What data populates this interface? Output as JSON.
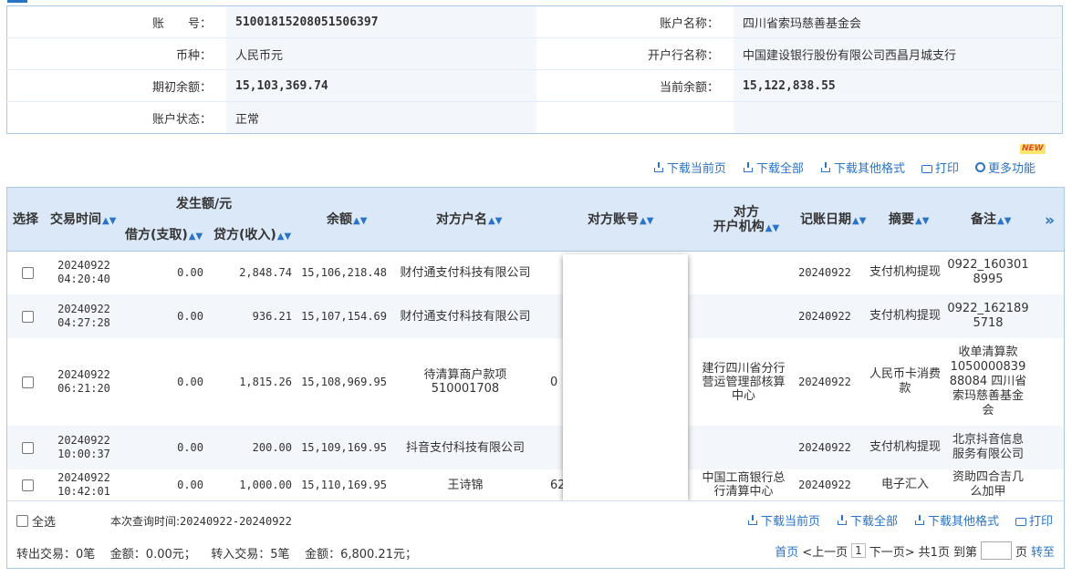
{
  "account": {
    "acct_no_label": "账　　号：",
    "acct_no": "51001815208051506397",
    "acct_name_label": "账户名称：",
    "acct_name": "四川省索玛慈善基金会",
    "currency_label": "币种：",
    "currency": "人民币元",
    "bank_label": "开户行名称：",
    "bank": "中国建设银行股份有限公司西昌月城支行",
    "opening_label": "期初余额：",
    "opening": "15,103,369.74",
    "current_label": "当前余额：",
    "current": "15,122,838.55",
    "status_label": "账户状态：",
    "status": "正常"
  },
  "toolbar": {
    "download_page": "下载当前页",
    "download_all": "下载全部",
    "download_other": "下载其他格式",
    "print": "打印",
    "more": "更多功能",
    "new_badge": "NEW"
  },
  "headers": {
    "select": "选择",
    "time": "交易时间",
    "amount_group": "发生额/元",
    "debit": "借方(支取)",
    "credit": "贷方(收入)",
    "balance": "余额",
    "cp_name": "对方户名",
    "cp_acct": "对方账号",
    "cp_bank_l1": "对方",
    "cp_bank_l2": "开户机构",
    "book_date": "记账日期",
    "memo": "摘要",
    "note": "备注",
    "more_arrow": "»"
  },
  "rows": [
    {
      "time_d": "20240922",
      "time_t": "04:20:40",
      "debit": "0.00",
      "credit": "2,848.74",
      "balance": "15,106,218.48",
      "cp_name": "财付通支付科技有限公司",
      "cp_acct": "",
      "cp_bank": "",
      "date": "20240922",
      "memo": "支付机构提现",
      "note": "0922_160301 8995"
    },
    {
      "time_d": "20240922",
      "time_t": "04:27:28",
      "debit": "0.00",
      "credit": "936.21",
      "balance": "15,107,154.69",
      "cp_name": "财付通支付科技有限公司",
      "cp_acct": "",
      "cp_bank": "",
      "date": "20240922",
      "memo": "支付机构提现",
      "note": "0922_162189 5718"
    },
    {
      "time_d": "20240922",
      "time_t": "06:21:20",
      "debit": "0.00",
      "credit": "1,815.26",
      "balance": "15,108,969.95",
      "cp_name": "待清算商户款项510001708",
      "cp_acct": "0",
      "cp_bank": "建行四川省分行营运管理部核算中心",
      "date": "20240922",
      "memo": "人民币卡消费款",
      "note": "收单清算款 1050000839 88084 四川省索玛慈善基金会"
    },
    {
      "time_d": "20240922",
      "time_t": "10:00:37",
      "debit": "0.00",
      "credit": "200.00",
      "balance": "15,109,169.95",
      "cp_name": "抖音支付科技有限公司",
      "cp_acct": "",
      "cp_bank": "",
      "date": "20240922",
      "memo": "支付机构提现",
      "note": "北京抖音信息服务有限公司"
    },
    {
      "time_d": "20240922",
      "time_t": "10:42:01",
      "debit": "0.00",
      "credit": "1,000.00",
      "balance": "15,110,169.95",
      "cp_name": "王诗锦",
      "cp_acct": "62",
      "cp_bank": "中国工商银行总行清算中心",
      "date": "20240922",
      "memo": "电子汇入",
      "note": "资助四合吉几么加甲"
    }
  ],
  "footer": {
    "select_all": "全选",
    "range_label": "本次查询时间:",
    "range": "20240922-20240922",
    "summary": "转出交易：0笔    金额：0.00元；    转入交易：5笔    金额：6,800.21元；",
    "pager_first": "首页",
    "pager_prev": "<上一页",
    "pager_cur": "1",
    "pager_next": "下一页>",
    "pager_total": "共1页",
    "pager_goto": "到第",
    "pager_page": "页",
    "pager_go": "转至"
  }
}
